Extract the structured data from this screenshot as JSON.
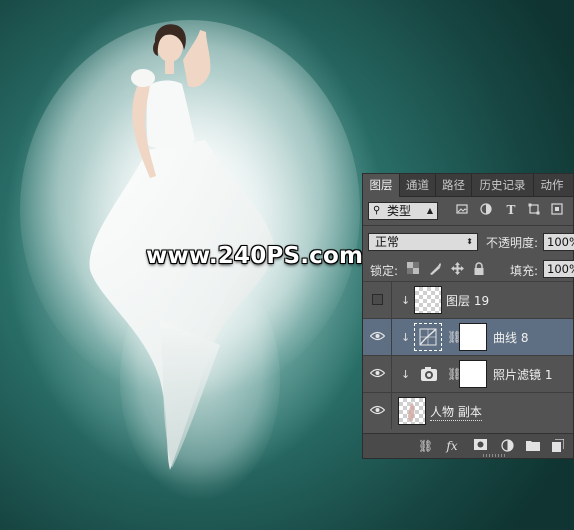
{
  "watermark": "www.240PS.com",
  "layers_panel": {
    "tabs": [
      "图层",
      "通道",
      "路径",
      "历史记录",
      "动作"
    ],
    "active_tab": "图层",
    "filter_kind": "类型",
    "blend_mode": "正常",
    "opacity_label": "不透明度:",
    "opacity_value": "100%",
    "lock_label": "锁定:",
    "fill_label": "填充:",
    "fill_value": "100%",
    "layers": [
      {
        "name": "图层 19",
        "visible": false,
        "clipped": true,
        "selected": false,
        "thumb": "transparent",
        "mask": false
      },
      {
        "name": "曲线 8",
        "visible": true,
        "clipped": true,
        "selected": true,
        "thumb": "curves-adjustment",
        "mask": true
      },
      {
        "name": "照片滤镜 1",
        "visible": true,
        "clipped": true,
        "selected": false,
        "thumb": "photo-filter-adjustment",
        "mask": true
      },
      {
        "name": "人物 副本",
        "visible": true,
        "clipped": false,
        "selected": false,
        "thumb": "person",
        "mask": false
      }
    ],
    "bottom_icons": [
      "link-icon",
      "fx-icon",
      "add-mask-icon",
      "adjustment-icon",
      "group-folder-icon",
      "new-layer-icon"
    ],
    "colors": {
      "panel_bg": "#535353",
      "selected_row": "#5f6f83",
      "tab_bar": "#3c3c3c"
    }
  },
  "canvas": {
    "background_colors": [
      "#2a6f69",
      "#174642"
    ]
  }
}
